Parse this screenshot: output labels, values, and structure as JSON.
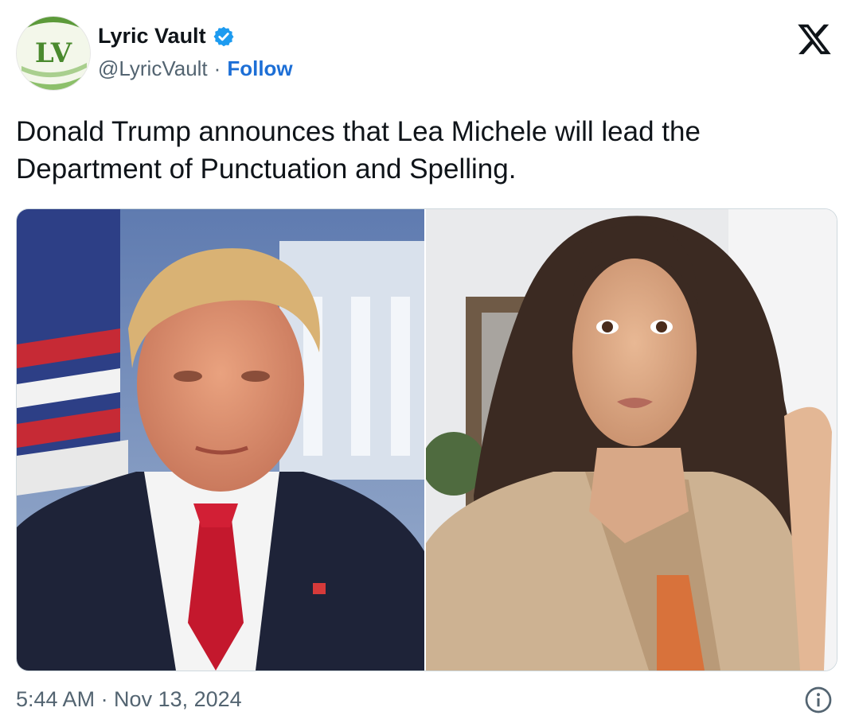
{
  "account": {
    "display_name": "Lyric Vault",
    "handle": "@LyricVault",
    "separator": "·",
    "follow_label": "Follow",
    "avatar_initials": "LV",
    "verified": true
  },
  "brand": {
    "logo": "x-logo"
  },
  "tweet": {
    "text": "Donald Trump announces that Lea Michele will lead the Department of Punctuation and Spelling.",
    "timestamp": "5:44 AM · Nov 13, 2024"
  },
  "media": {
    "images": [
      "portrait-left",
      "portrait-right"
    ]
  },
  "colors": {
    "link": "#1d6fd6",
    "verified": "#1d9bf0",
    "text": "#0f1419",
    "muted": "#536471",
    "avatar_green": "#5c9a3a"
  },
  "icons": [
    "verified-badge-icon",
    "x-logo-icon",
    "info-icon"
  ]
}
